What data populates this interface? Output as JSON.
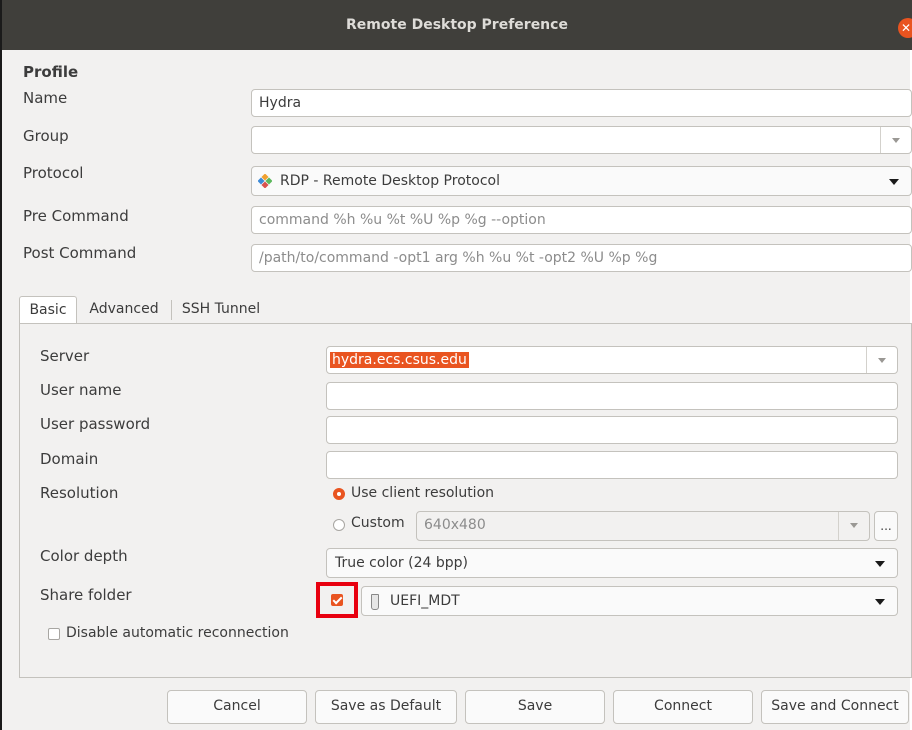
{
  "window": {
    "title": "Remote Desktop Preference",
    "close_glyph": "✕",
    "accent_color": "#e95420"
  },
  "profile": {
    "section_label": "Profile",
    "name_label": "Name",
    "name_value": "Hydra",
    "group_label": "Group",
    "group_value": "",
    "protocol_label": "Protocol",
    "protocol_value": "RDP - Remote Desktop Protocol",
    "protocol_icon": "rdp-protocol-icon",
    "pre_command_label": "Pre Command",
    "pre_command_placeholder": "command %h %u %t %U %p %g --option",
    "post_command_label": "Post Command",
    "post_command_placeholder": "/path/to/command -opt1 arg %h %u %t -opt2 %U %p %g"
  },
  "tabs": [
    {
      "label": "Basic",
      "active": true
    },
    {
      "label": "Advanced",
      "active": false
    },
    {
      "label": "SSH Tunnel",
      "active": false
    }
  ],
  "basic": {
    "server_label": "Server",
    "server_value": "hydra.ecs.csus.edu",
    "username_label": "User name",
    "username_value": "",
    "password_label": "User password",
    "password_value": "",
    "domain_label": "Domain",
    "domain_value": "",
    "resolution_label": "Resolution",
    "resolution_client_label": "Use client resolution",
    "resolution_custom_label": "Custom",
    "resolution_custom_value": "640x480",
    "resolution_more_label": "...",
    "color_depth_label": "Color depth",
    "color_depth_value": "True color (24 bpp)",
    "share_folder_label": "Share folder",
    "share_folder_checked": true,
    "share_folder_value": "UEFI_MDT",
    "disable_reconnect_label": "Disable automatic reconnection",
    "disable_reconnect_checked": false
  },
  "buttons": {
    "cancel": "Cancel",
    "save_default": "Save as Default",
    "save": "Save",
    "connect": "Connect",
    "save_connect": "Save and Connect"
  }
}
